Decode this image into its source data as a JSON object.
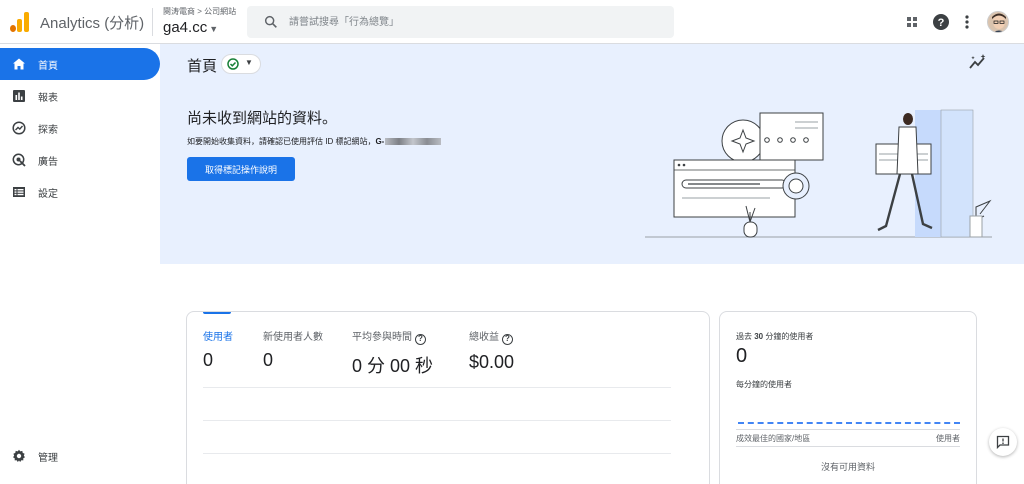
{
  "app": {
    "title": "Analytics (分析)"
  },
  "account": {
    "breadcrumb": "闋涛電商 > 公司網站",
    "property_name": "ga4.cc"
  },
  "search": {
    "placeholder": "請嘗試搜尋「行為總覽」"
  },
  "topbar_icons": [
    "apps-grid-icon",
    "help-icon",
    "more-vert-icon"
  ],
  "sidebar": {
    "items": [
      {
        "label": "首頁",
        "icon": "home-icon",
        "active": true
      },
      {
        "label": "報表",
        "icon": "bar-chart-icon",
        "active": false
      },
      {
        "label": "探索",
        "icon": "explore-icon",
        "active": false
      },
      {
        "label": "廣告",
        "icon": "ads-icon",
        "active": false
      },
      {
        "label": "設定",
        "icon": "list-icon",
        "active": false
      }
    ],
    "admin": {
      "label": "管理",
      "icon": "gear-icon"
    }
  },
  "home": {
    "title": "首頁",
    "heading": "尚未收到網站的資料。",
    "description": "如要開始收集資料，請確認已使用評估 ID 標記網站，",
    "tag_prefix": "G-",
    "button_label": "取得標記操作說明"
  },
  "metrics": [
    {
      "label": "使用者",
      "value": "0",
      "selected": true,
      "help": false
    },
    {
      "label": "新使用者人數",
      "value": "0",
      "selected": false,
      "help": false
    },
    {
      "label": "平均參與時間",
      "value": "0 分 00 秒",
      "selected": false,
      "help": true
    },
    {
      "label": "總收益",
      "value": "$0.00",
      "selected": false,
      "help": true
    }
  ],
  "realtime": {
    "title_prefix": "過去 ",
    "title_bold": "30",
    "title_suffix": " 分鐘的使用者",
    "value": "0",
    "per_minute_label": "每分鐘的使用者",
    "col_left": "成效最佳的國家/地區",
    "col_right": "使用者",
    "empty_text": "沒有可用資料"
  },
  "colors": {
    "primary": "#1a73e8",
    "hero_bg": "#e8f0fe",
    "logo_orange": "#f9ab00",
    "logo_dark": "#e37400",
    "success": "#188038"
  }
}
